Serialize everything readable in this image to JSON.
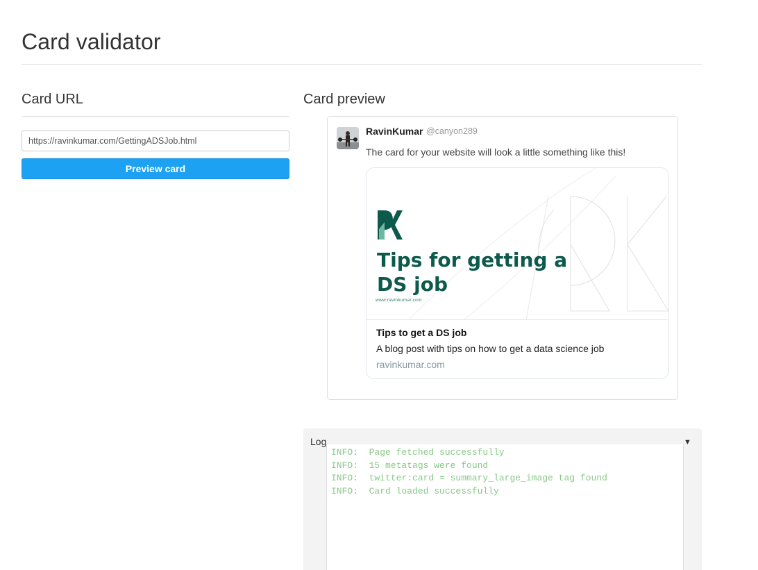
{
  "page": {
    "title": "Card validator"
  },
  "card_url": {
    "heading": "Card URL",
    "input_value": "https://ravinkumar.com/GettingADSJob.html",
    "button_label": "Preview card"
  },
  "preview": {
    "heading": "Card preview",
    "author_name": "RavinKumar",
    "author_handle": "@canyon289",
    "tweet_text": "The card for your website will look a little something like this!",
    "card": {
      "image_heading": "Tips for getting a DS job",
      "image_site": "www.ravinkumar.com",
      "title": "Tips to get a DS job",
      "description": "A blog post with tips on how to get a data science job",
      "domain": "ravinkumar.com"
    }
  },
  "log": {
    "title": "Log",
    "toggle_icon": "caret-down-icon",
    "lines": [
      "INFO:  Page fetched successfully",
      "INFO:  15 metatags were found",
      "INFO:  twitter:card = summary_large_image tag found",
      "INFO:  Card loaded successfully"
    ]
  },
  "colors": {
    "accent": "#1da1f2",
    "brand_green": "#0d5a4c",
    "log_text": "#87c987"
  }
}
